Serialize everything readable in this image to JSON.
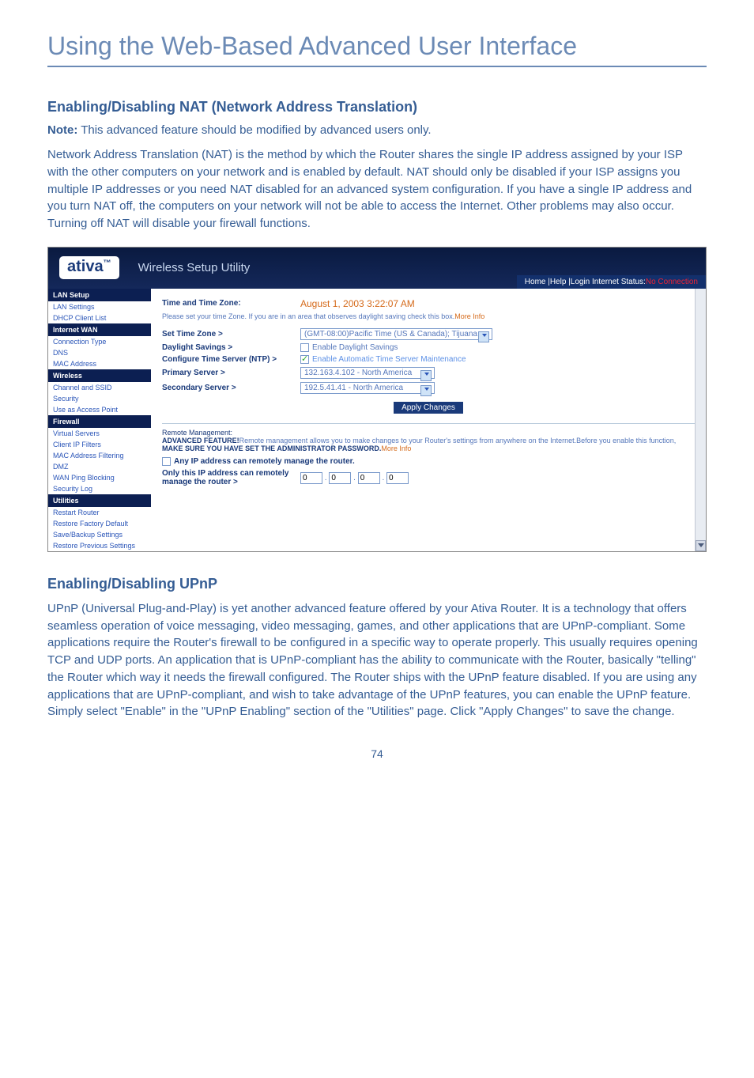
{
  "page": {
    "title": "Using the Web-Based Advanced User Interface",
    "number": "74"
  },
  "section1": {
    "heading": "Enabling/Disabling NAT (Network Address Translation)",
    "note_label": "Note:",
    "note_text": " This advanced feature should be modified by advanced users only.",
    "body": "Network Address Translation (NAT) is the method by which the Router shares the single IP address assigned by your ISP with the other computers on your network and is enabled by default. NAT should only be disabled if your ISP assigns you multiple IP addresses or you need NAT disabled for an advanced system configuration. If you have a single IP address and you turn NAT off, the computers on your network will not be able to access the Internet. Other problems may also occur. Turning off NAT will disable your firewall functions."
  },
  "section2": {
    "heading": "Enabling/Disabling UPnP",
    "body": "UPnP (Universal Plug-and-Play) is yet another advanced feature offered by your Ativa Router. It is a technology that offers seamless operation of voice messaging, video messaging, games, and other applications that are UPnP-compliant. Some applications require the Router's firewall to be configured in a specific way to operate properly. This usually requires opening TCP and UDP ports. An application that is UPnP-compliant has the ability to communicate with the Router, basically \"telling\" the Router which way it needs the firewall configured. The Router ships with the UPnP feature disabled. If you are using any applications that are UPnP-compliant, and wish to take advantage of the UPnP features, you can enable the UPnP feature. Simply select \"Enable\" in the \"UPnP Enabling\" section of the \"Utilities\" page. Click \"Apply Changes\" to save the change."
  },
  "screenshot": {
    "logo": "ativa",
    "header_title": "Wireless Setup Utility",
    "header_links": "Home |Help |Login   Internet Status:",
    "header_status": "No Connection",
    "nav": {
      "groups": [
        {
          "head": "LAN Setup",
          "items": [
            "LAN Settings",
            "DHCP Client List"
          ]
        },
        {
          "head": "Internet WAN",
          "items": [
            "Connection Type",
            "DNS",
            "MAC Address"
          ]
        },
        {
          "head": "Wireless",
          "items": [
            "Channel and SSID",
            "Security",
            "Use as Access Point"
          ]
        },
        {
          "head": "Firewall",
          "items": [
            "Virtual Servers",
            "Client IP Filters",
            "MAC Address Filtering",
            "DMZ",
            "WAN Ping Blocking",
            "Security Log"
          ]
        },
        {
          "head": "Utilities",
          "items": [
            "Restart Router",
            "Restore Factory Default",
            "Save/Backup Settings",
            "Restore Previous Settings"
          ]
        }
      ]
    },
    "main": {
      "time_label": "Time and Time Zone:",
      "time_value": "August 1, 2003  3:22:07 AM",
      "time_desc": "Please set your time Zone. If you are in an area that observes daylight saving check this box.",
      "time_more": "More Info",
      "set_tz_label": "Set Time Zone >",
      "set_tz_value": "(GMT-08:00)Pacific Time (US & Canada); Tijuana",
      "daylight_label": "Daylight Savings >",
      "daylight_cb": "Enable Daylight Savings",
      "ntp_label": "Configure Time Server (NTP) >",
      "ntp_cb": "Enable Automatic Time Server Maintenance",
      "primary_label": "Primary Server >",
      "primary_value": "132.163.4.102 - North America",
      "secondary_label": "Secondary Server >",
      "secondary_value": "192.5.41.41 - North America",
      "apply_btn": "Apply Changes",
      "remote_head": "Remote Management:",
      "remote_text1": "ADVANCED FEATURE!",
      "remote_text2": "Remote management allows you to make changes to your Router's settings from anywhere on the Internet.Before you enable this function, ",
      "remote_text3": "MAKE SURE YOU HAVE SET THE ADMINISTRATOR PASSWORD.",
      "remote_more": "More Info",
      "anyip_cb": "Any IP address can remotely manage the router.",
      "onlyip_label": "Only this IP address can remotely manage the router >",
      "ip_fields": [
        "0",
        "0",
        "0",
        "0"
      ]
    }
  }
}
